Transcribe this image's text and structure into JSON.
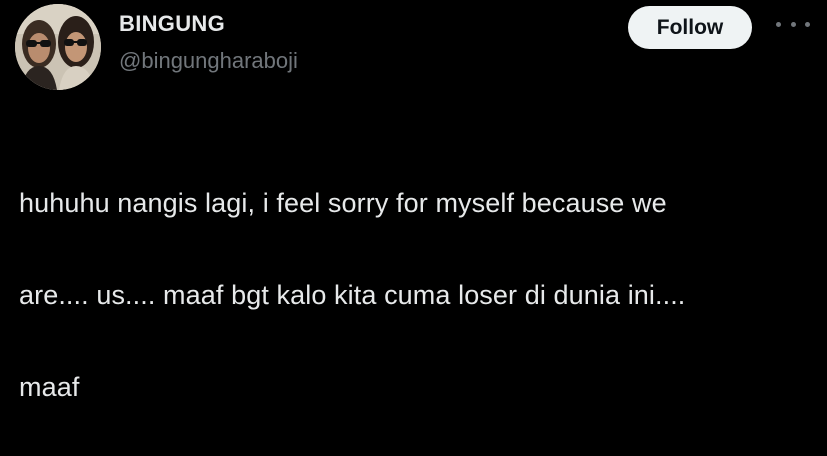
{
  "author": {
    "display_name": "BINGUNG",
    "handle": "@bingungharaboji",
    "avatar_icon": "avatar-photo"
  },
  "actions": {
    "follow_label": "Follow",
    "more_icon": "more-options-icon"
  },
  "tweet": {
    "line1": "huhuhu nangis lagi, i feel sorry for myself because we",
    "line2": "are.... us.... maaf bgt kalo kita cuma loser di dunia ini....",
    "line3": "maaf"
  },
  "colors": {
    "background": "#000000",
    "text": "#e7e9ea",
    "secondary_text": "#71767b",
    "button_bg": "#eff3f4",
    "button_text": "#0f1419"
  }
}
